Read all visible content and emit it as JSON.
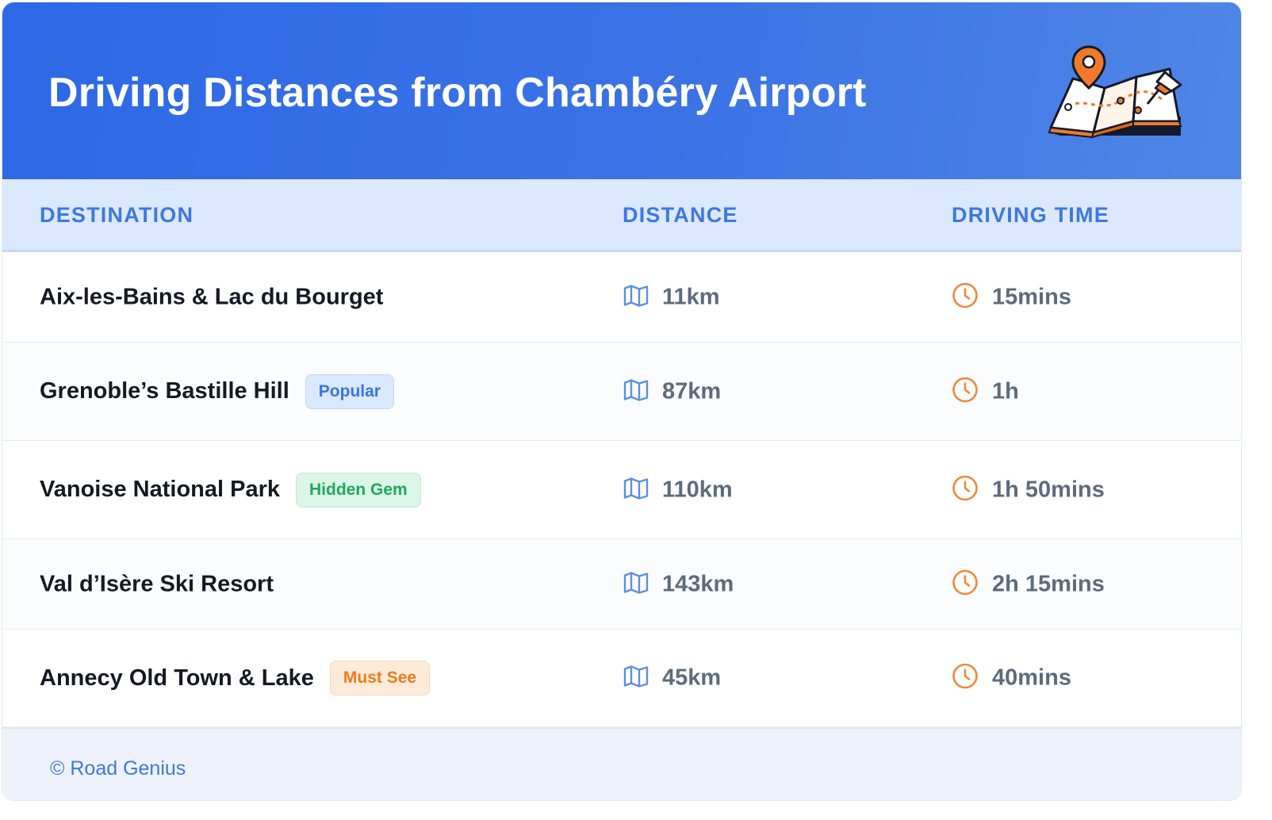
{
  "header": {
    "title": "Driving Distances from Chambéry Airport",
    "illustration_icon": "map-with-pins-icon"
  },
  "table": {
    "columns": [
      "DESTINATION",
      "DISTANCE",
      "DRIVING TIME"
    ],
    "rows": [
      {
        "destination": "Aix-les-Bains & Lac du Bourget",
        "badge": "",
        "badge_color": "",
        "distance": "11km",
        "time": "15mins"
      },
      {
        "destination": "Grenoble’s Bastille Hill",
        "badge": "Popular",
        "badge_color": "blue",
        "distance": "87km",
        "time": "1h"
      },
      {
        "destination": "Vanoise National Park",
        "badge": "Hidden Gem",
        "badge_color": "green",
        "distance": "110km",
        "time": "1h 50mins"
      },
      {
        "destination": "Val d’Isère Ski Resort",
        "badge": "",
        "badge_color": "",
        "distance": "143km",
        "time": "2h 15mins"
      },
      {
        "destination": "Annecy Old Town & Lake",
        "badge": "Must See",
        "badge_color": "orange",
        "distance": "45km",
        "time": "40mins"
      }
    ],
    "distance_icon": "map-icon",
    "time_icon": "clock-icon"
  },
  "footer": {
    "text": "© Road Genius"
  },
  "colors": {
    "header_start": "#2d68e6",
    "header_end": "#4f86e6",
    "accent_blue": "#3d78e0",
    "clock_orange": "#f0883a",
    "map_icon_blue": "#5b8ee6"
  }
}
